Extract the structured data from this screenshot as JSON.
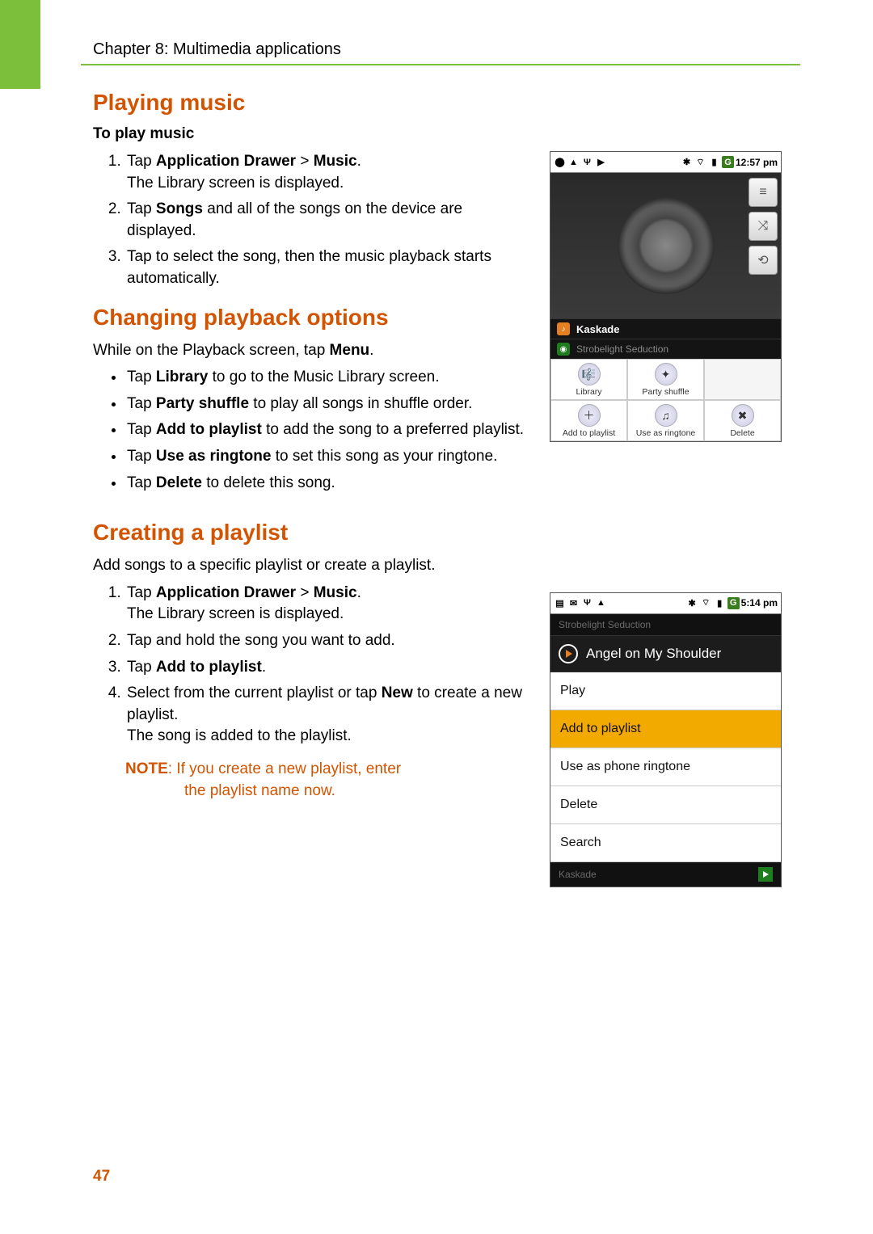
{
  "chapter_header": "Chapter 8: Multimedia applications",
  "page_number": "47",
  "s1": {
    "title": "Playing music",
    "subhead": "To play music",
    "step1_a": "Tap ",
    "step1_b": "Application Drawer",
    "step1_c": " > ",
    "step1_d": "Music",
    "step1_e": ".",
    "step1_line2": "The Library screen is displayed.",
    "step2_a": "Tap ",
    "step2_b": "Songs",
    "step2_c": " and all of the songs on the device are displayed.",
    "step3": "Tap to select the song, then the music playback starts automatically."
  },
  "s2": {
    "title": "Changing playback options",
    "intro_a": "While on the Playback screen, tap ",
    "intro_b": "Menu",
    "intro_c": ".",
    "b1_a": "Tap ",
    "b1_b": "Library",
    "b1_c": " to go to the Music Library screen.",
    "b2_a": "Tap ",
    "b2_b": "Party shuffle",
    "b2_c": " to play all songs in shuffle order.",
    "b3_a": "Tap ",
    "b3_b": "Add to playlist",
    "b3_c": " to add the song to a preferred playlist.",
    "b4_a": "Tap ",
    "b4_b": "Use as ringtone",
    "b4_c": " to set this song as your ringtone.",
    "b5_a": "Tap ",
    "b5_b": "Delete",
    "b5_c": " to delete this song."
  },
  "s3": {
    "title": "Creating a playlist",
    "intro": "Add songs to a specific playlist or create a playlist.",
    "step1_a": "Tap ",
    "step1_b": "Application Drawer",
    "step1_c": " > ",
    "step1_d": "Music",
    "step1_e": ".",
    "step1_line2": "The Library screen is displayed.",
    "step2": "Tap and hold the song you want to add.",
    "step3_a": "Tap ",
    "step3_b": "Add to playlist",
    "step3_c": ".",
    "step4_a": "Select from the current playlist or tap ",
    "step4_b": "New",
    "step4_c": " to create a new playlist.",
    "step4_line2": "The song is added to the playlist.",
    "note_label": "NOTE",
    "note_colon": ": ",
    "note_text1": "If you create a new playlist, enter",
    "note_text2": "the playlist name now."
  },
  "shot1": {
    "time": "12:57 pm",
    "artist": "Kaskade",
    "album": "Strobelight Seduction",
    "menu": {
      "library": "Library",
      "party_shuffle": "Party shuffle",
      "add_to_playlist": "Add to playlist",
      "use_as_ringtone": "Use as ringtone",
      "delete": "Delete"
    }
  },
  "shot2": {
    "time": "5:14 pm",
    "header_dim": "Strobelight Seduction",
    "song_title": "Angel on My Shoulder",
    "items": {
      "play": "Play",
      "add": "Add to playlist",
      "ringtone": "Use as phone ringtone",
      "delete": "Delete",
      "search": "Search"
    },
    "footer_dim": "Kaskade"
  }
}
